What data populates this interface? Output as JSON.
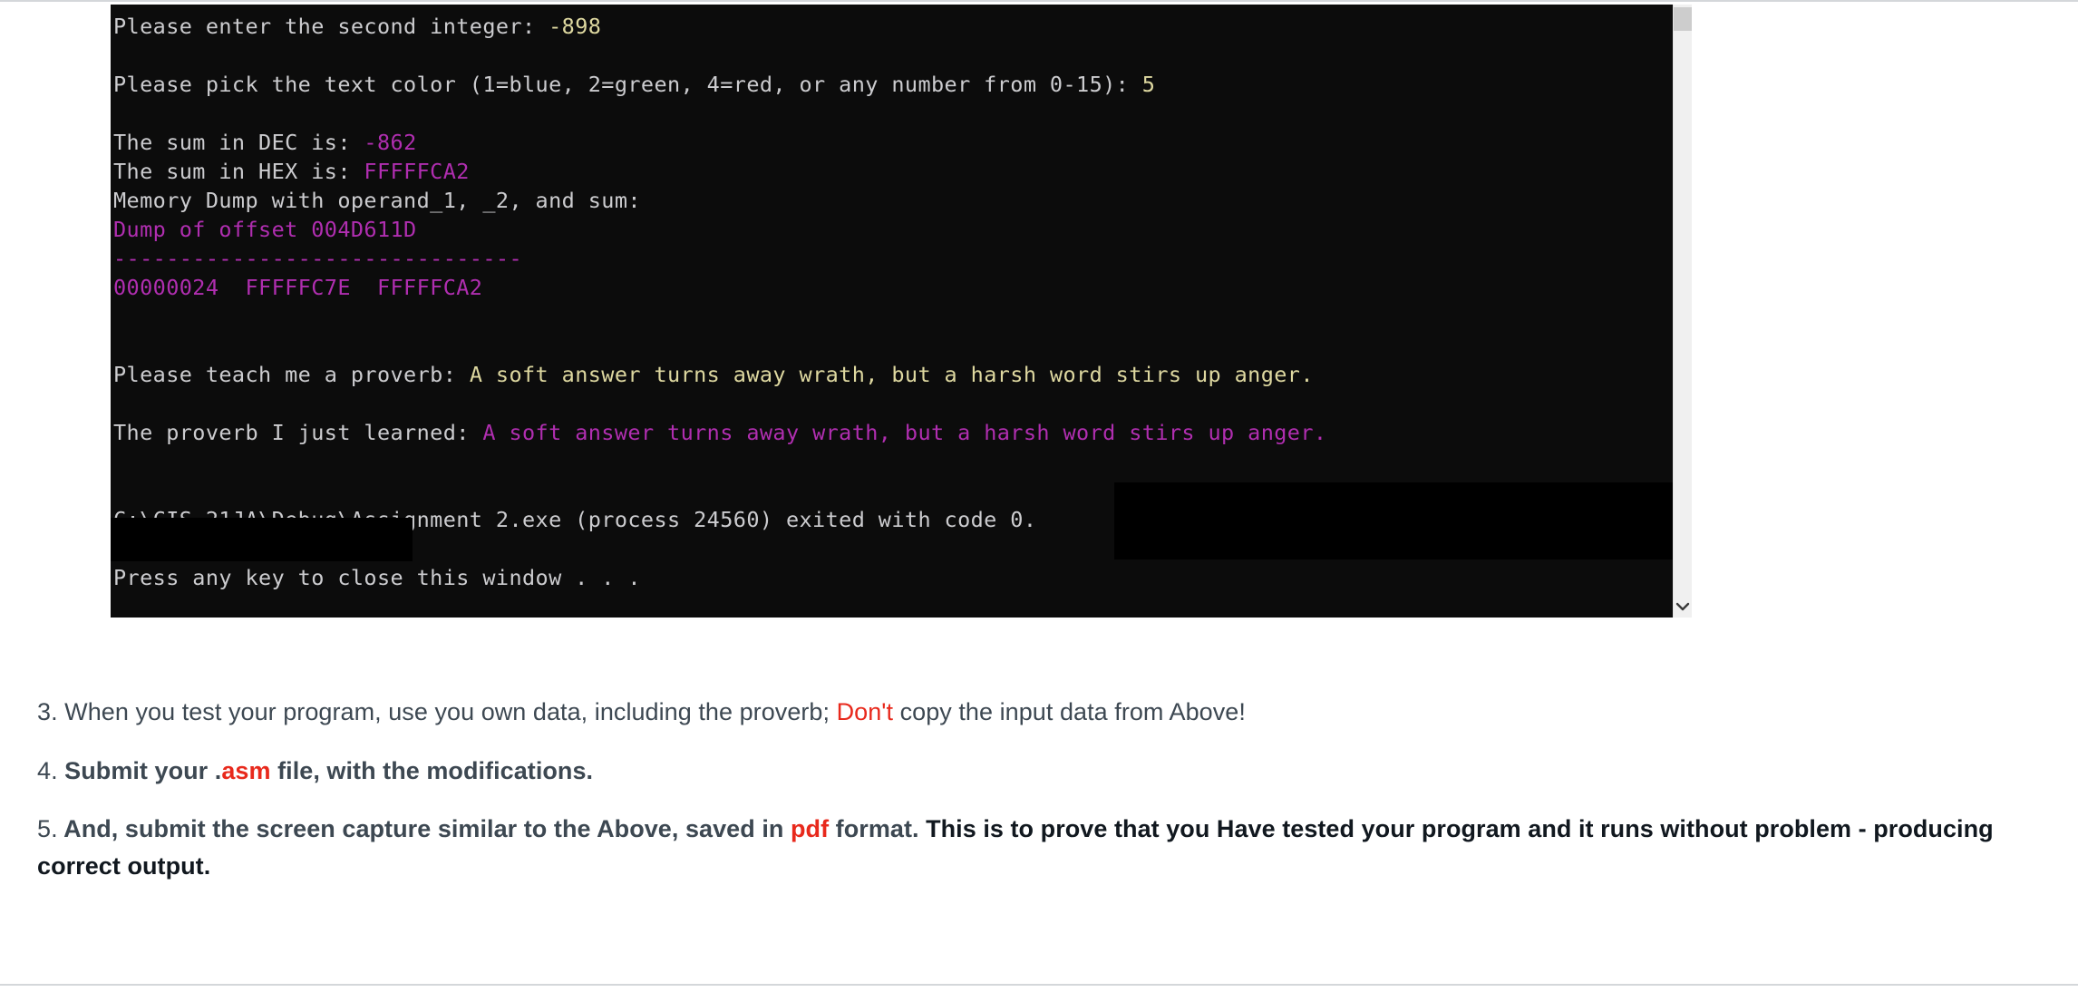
{
  "console": {
    "lines": [
      {
        "segments": [
          {
            "text": "Please enter the second integer: ",
            "style": "white"
          },
          {
            "text": "-898",
            "style": "yellow"
          }
        ]
      },
      {
        "segments": []
      },
      {
        "segments": [
          {
            "text": "Please pick the text color (1=blue, 2=green, 4=red, or any number from 0-15): ",
            "style": "white"
          },
          {
            "text": "5",
            "style": "yellow"
          }
        ]
      },
      {
        "segments": []
      },
      {
        "segments": [
          {
            "text": "The sum in DEC is: ",
            "style": "white"
          },
          {
            "text": "-862",
            "style": "magenta"
          }
        ]
      },
      {
        "segments": [
          {
            "text": "The sum in HEX is: ",
            "style": "white"
          },
          {
            "text": "FFFFFCA2",
            "style": "magenta"
          }
        ]
      },
      {
        "segments": [
          {
            "text": "Memory Dump with operand_1, _2, and sum:",
            "style": "white"
          }
        ]
      },
      {
        "segments": [
          {
            "text": "Dump of offset 004D611D",
            "style": "magenta"
          }
        ]
      },
      {
        "segments": [
          {
            "text": "-------------------------------",
            "style": "magenta"
          }
        ]
      },
      {
        "segments": [
          {
            "text": "00000024  FFFFFC7E  FFFFFCA2",
            "style": "magenta"
          }
        ]
      },
      {
        "segments": []
      },
      {
        "segments": []
      },
      {
        "segments": [
          {
            "text": "Please teach me a proverb: ",
            "style": "white"
          },
          {
            "text": "A soft answer turns away wrath, but a harsh word stirs up anger.",
            "style": "yellow"
          }
        ]
      },
      {
        "segments": []
      },
      {
        "segments": [
          {
            "text": "The proverb I just learned: ",
            "style": "white"
          },
          {
            "text": "A soft answer turns away wrath, but a harsh word stirs up anger.",
            "style": "magenta"
          }
        ]
      },
      {
        "segments": []
      },
      {
        "segments": []
      },
      {
        "segments": [
          {
            "text": "C:\\CIS 21JA\\Debug\\Assignment 2.exe (process 24560) exited with code 0.",
            "style": "white"
          }
        ]
      },
      {
        "segments": []
      },
      {
        "segments": [
          {
            "text": "Press any key to close this window . . .",
            "style": "white"
          }
        ]
      }
    ],
    "colors": {
      "background": "#0c0c0c",
      "default_text": "#cccccf",
      "input_echo": "#ded8a0",
      "highlight": "#b02eb0"
    }
  },
  "scrollbar": {
    "down_arrow_icon": "chevron-down-icon"
  },
  "instructions": {
    "item3": {
      "number": "3.",
      "text_before": " When you test your program, use you own data, including the proverb; ",
      "emphasis": "Don't",
      "text_after": " copy the input data from Above!"
    },
    "item4": {
      "number": "4.",
      "text_before": " Submit your ",
      "dot": ".",
      "emphasis": "asm",
      "text_after": " file, with the modifications."
    },
    "item5": {
      "number": "5.",
      "text_before": " And, submit the screen capture similar to the Above, saved in ",
      "emphasis": "pdf",
      "text_middle": " format. ",
      "text_strong": "This is to prove that you Have tested your program and it runs without problem - producing correct output."
    },
    "colors": {
      "body_text": "#3d4852",
      "accent_red": "#e8291c",
      "strong_text": "#11181f"
    }
  }
}
